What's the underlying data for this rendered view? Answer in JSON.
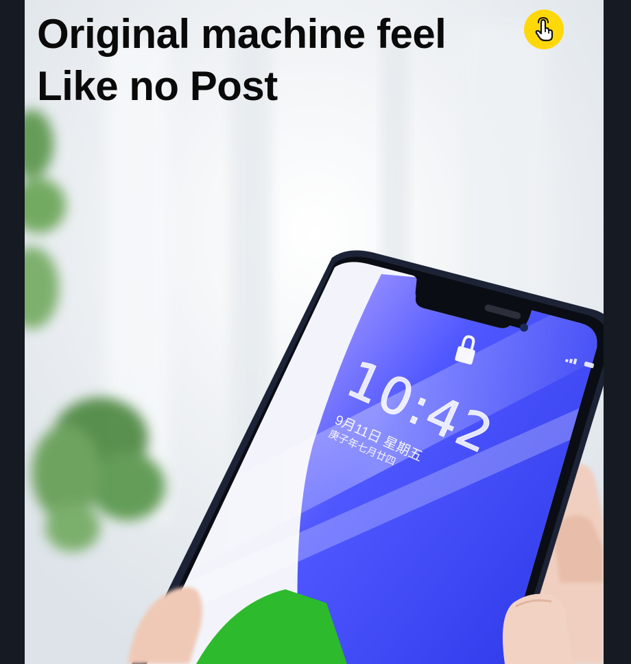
{
  "headline": {
    "line1": "Original machine feel",
    "line2": "Like no Post"
  },
  "badge": {
    "icon": "tap-hand-icon",
    "color": "#ffd80a"
  },
  "phone_screen": {
    "time": "10:42",
    "date": "9月11日 星期五",
    "lunar_date": "庚子年七月廿四"
  },
  "colors": {
    "screen_blue": "#3340e8",
    "screen_green": "#2dbb2d",
    "frame_dark": "#161a22"
  }
}
